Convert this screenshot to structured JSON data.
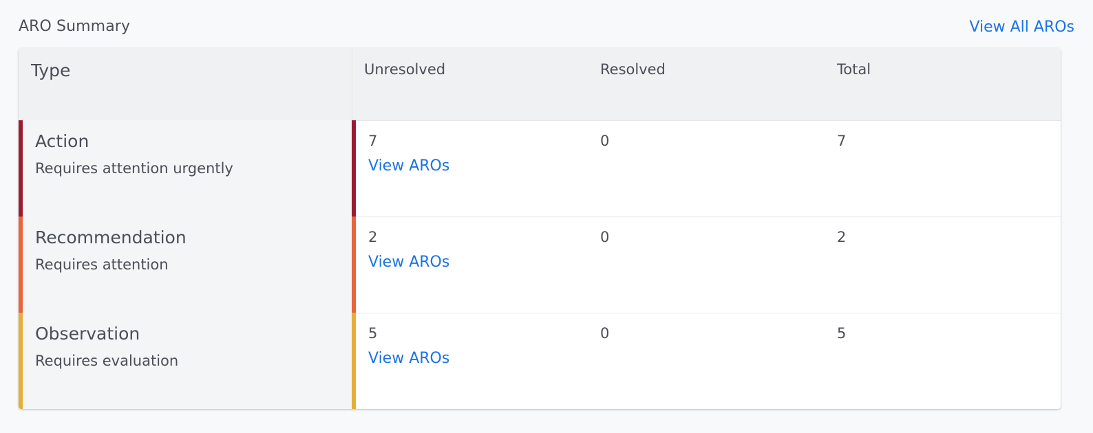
{
  "summary": {
    "title": "ARO Summary",
    "view_all_label": "View All AROs"
  },
  "table": {
    "headers": {
      "type": "Type",
      "unresolved": "Unresolved",
      "resolved": "Resolved",
      "total": "Total"
    },
    "rows": [
      {
        "name": "Action",
        "description": "Requires attention urgently",
        "unresolved": "7",
        "resolved": "0",
        "total": "7",
        "link_label": "View AROs",
        "color": "#9b1b30"
      },
      {
        "name": "Recommendation",
        "description": "Requires attention",
        "unresolved": "2",
        "resolved": "0",
        "total": "2",
        "link_label": "View AROs",
        "color": "#e8643a"
      },
      {
        "name": "Observation",
        "description": "Requires evaluation",
        "unresolved": "5",
        "resolved": "0",
        "total": "5",
        "link_label": "View AROs",
        "color": "#e5ae3a"
      }
    ]
  },
  "colors": {
    "link": "#1a73e8",
    "text": "#4a4f57",
    "header_bg": "#f0f1f3",
    "type_cell_bg": "#f4f5f7"
  }
}
